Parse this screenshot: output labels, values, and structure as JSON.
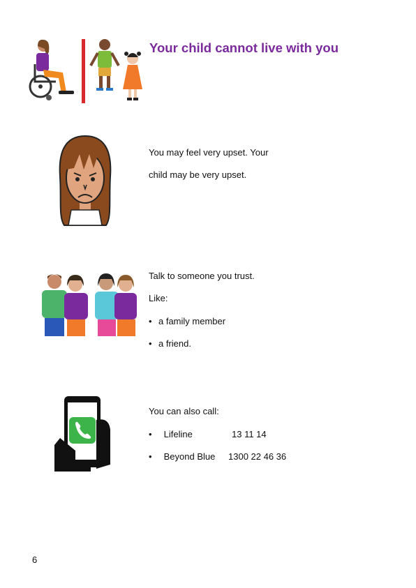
{
  "header": {
    "title": "Your child cannot live with you"
  },
  "section_upset": {
    "line1": "You may feel very upset. Your",
    "line2": "child may be very upset."
  },
  "section_trust": {
    "line1": "Talk to someone you trust.",
    "line2": "Like:",
    "bullets": [
      "a family member",
      "a friend."
    ]
  },
  "section_call": {
    "intro": "You can also call:",
    "contacts": [
      {
        "name": "Lifeline",
        "number": "13 11 14"
      },
      {
        "name": "Beyond Blue",
        "number": "1300 22 46 36"
      }
    ]
  },
  "footer": {
    "page_number": "6"
  },
  "icons": {
    "header": "parent-separated-from-children-icon",
    "upset": "upset-face-icon",
    "trust": "group-of-people-icon",
    "call": "phone-in-hand-icon"
  },
  "colors": {
    "title": "#7a2a9c",
    "divider_red": "#d92b2b",
    "phone_green": "#3cb44a"
  }
}
